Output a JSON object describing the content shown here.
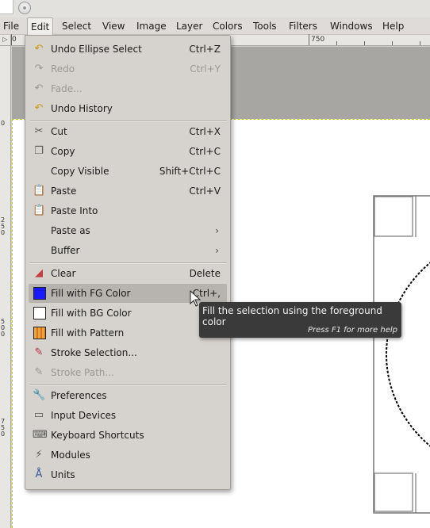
{
  "menubar": {
    "items": [
      "File",
      "Edit",
      "Select",
      "View",
      "Image",
      "Layer",
      "Colors",
      "Tools",
      "Filters",
      "Windows",
      "Help"
    ],
    "active": "Edit"
  },
  "ruler": {
    "corner": "▷",
    "h_labels": [
      "0",
      "750"
    ],
    "v_labels": [
      "0",
      "2 5 0",
      "5 0 0",
      "7 5 0"
    ]
  },
  "edit_menu": {
    "items": [
      {
        "label": "Undo Ellipse Select",
        "accel": "Ctrl+Z",
        "icon": "undo-icon",
        "enabled": true
      },
      {
        "label": "Redo",
        "accel": "Ctrl+Y",
        "icon": "redo-icon",
        "enabled": false
      },
      {
        "label": "Fade...",
        "accel": "",
        "icon": "fade-icon",
        "enabled": false
      },
      {
        "label": "Undo History",
        "accel": "",
        "icon": "undo-history-icon",
        "enabled": true
      },
      {
        "label": "Cut",
        "accel": "Ctrl+X",
        "icon": "scissors-icon",
        "enabled": true
      },
      {
        "label": "Copy",
        "accel": "Ctrl+C",
        "icon": "copy-icon",
        "enabled": true
      },
      {
        "label": "Copy Visible",
        "accel": "Shift+Ctrl+C",
        "icon": "",
        "enabled": true
      },
      {
        "label": "Paste",
        "accel": "Ctrl+V",
        "icon": "paste-icon",
        "enabled": true
      },
      {
        "label": "Paste Into",
        "accel": "",
        "icon": "paste-into-icon",
        "enabled": true
      },
      {
        "label": "Paste as",
        "accel": "",
        "icon": "",
        "enabled": true,
        "submenu": true
      },
      {
        "label": "Buffer",
        "accel": "",
        "icon": "",
        "enabled": true,
        "submenu": true
      },
      {
        "label": "Clear",
        "accel": "Delete",
        "icon": "eraser-icon",
        "enabled": true
      },
      {
        "label": "Fill with FG Color",
        "accel": "Ctrl+,",
        "icon": "fg-color-swatch",
        "enabled": true,
        "highlighted": true,
        "color": "#1a1aff"
      },
      {
        "label": "Fill with BG Color",
        "accel": "",
        "icon": "bg-color-swatch",
        "enabled": true,
        "color": "#ffffff"
      },
      {
        "label": "Fill with Pattern",
        "accel": "",
        "icon": "pattern-swatch",
        "enabled": true,
        "color": "#f0a040"
      },
      {
        "label": "Stroke Selection...",
        "accel": "",
        "icon": "stroke-selection-icon",
        "enabled": true
      },
      {
        "label": "Stroke Path...",
        "accel": "",
        "icon": "stroke-path-icon",
        "enabled": false
      },
      {
        "label": "Preferences",
        "accel": "",
        "icon": "preferences-icon",
        "enabled": true
      },
      {
        "label": "Input Devices",
        "accel": "",
        "icon": "input-devices-icon",
        "enabled": true
      },
      {
        "label": "Keyboard Shortcuts",
        "accel": "",
        "icon": "keyboard-icon",
        "enabled": true
      },
      {
        "label": "Modules",
        "accel": "",
        "icon": "modules-icon",
        "enabled": true
      },
      {
        "label": "Units",
        "accel": "",
        "icon": "units-icon",
        "enabled": true
      }
    ]
  },
  "tooltip": {
    "text": "Fill the selection using the foreground color",
    "hint": "Press F1 for more help"
  }
}
